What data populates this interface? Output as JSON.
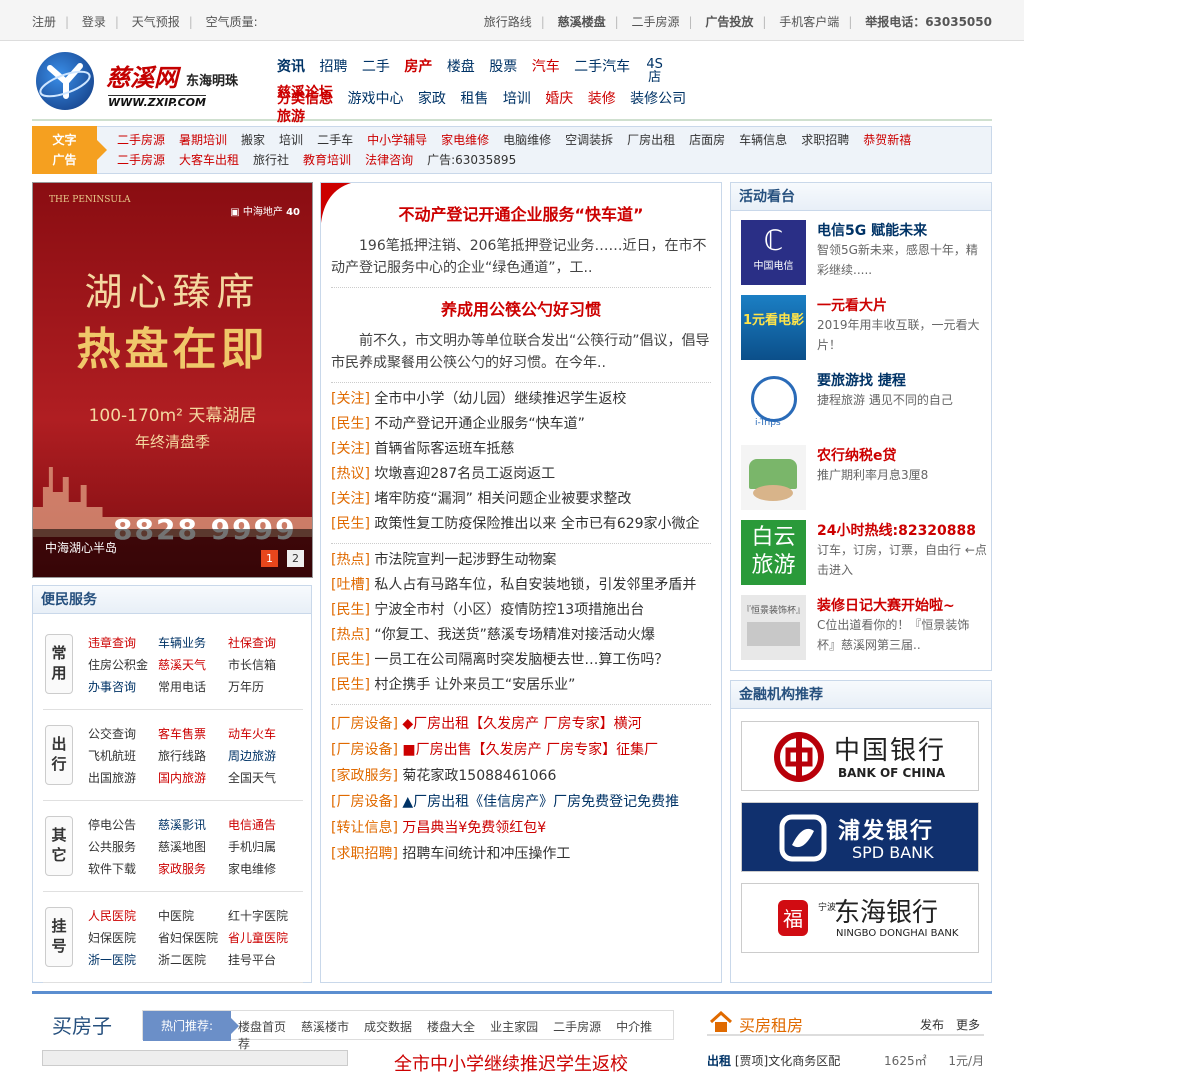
{
  "topbar": {
    "left": [
      "注册",
      "登录",
      "天气预报",
      "空气质量:"
    ],
    "right": [
      "旅行路线",
      "慈溪楼盘",
      "二手房源",
      "广告投放",
      "手机客户端"
    ],
    "hotline": "举报电话：63035050"
  },
  "logo": {
    "name": "慈溪网",
    "slogan": "东海明珠",
    "url": "WWW.ZXIP.COM"
  },
  "nav": {
    "row1": [
      "资讯",
      "招聘",
      "二手",
      "房产",
      "楼盘",
      "股票",
      "汽车",
      "二手汽车",
      "4S店",
      "慈溪论坛"
    ],
    "row2": [
      "分类信息",
      "游戏中心",
      "家政",
      "租售",
      "培训",
      "婚庆",
      "装修",
      "装修公司",
      "旅游"
    ]
  },
  "text_ad": {
    "label": [
      "文字",
      "广告"
    ],
    "items": [
      "二手房源",
      "暑期培训",
      "搬家",
      "培训",
      "二手车",
      "中小学辅导",
      "家电维修",
      "电脑维修",
      "空调装拆",
      "厂房出租",
      "店面房",
      "车辆信息",
      "求职招聘",
      "恭贺新禧",
      "二手房源",
      "大客车出租",
      "旅行社",
      "教育培训",
      "法律咨询",
      "广告:63035895"
    ]
  },
  "banner": {
    "peninsula": "THE PENINSULA",
    "brand": "40",
    "line1": "湖心臻席",
    "line2": "热盘在即",
    "line3": "100-170m² 天幕湖居",
    "line4": "年终清盘季",
    "phone": "8828 9999",
    "caption": "中海湖心半岛",
    "pages": [
      "1",
      "2"
    ]
  },
  "convenience": {
    "title": "便民服务",
    "groups": [
      {
        "tag": "常用",
        "links": [
          "违章查询",
          "车辆业务",
          "社保查询",
          "住房公积金",
          "慈溪天气",
          "市长信箱",
          "办事咨询",
          "常用电话",
          "万年历"
        ]
      },
      {
        "tag": "出行",
        "links": [
          "公交查询",
          "客车售票",
          "动车火车",
          "飞机航班",
          "旅行线路",
          "周边旅游",
          "出国旅游",
          "国内旅游",
          "全国天气"
        ]
      },
      {
        "tag": "其它",
        "links": [
          "停电公告",
          "慈溪影讯",
          "电信通告",
          "公共服务",
          "慈溪地图",
          "手机归属",
          "软件下载",
          "家政服务",
          "家电维修"
        ]
      },
      {
        "tag": "挂号",
        "links": [
          "人民医院",
          "中医院",
          "红十字医院",
          "妇保医院",
          "省妇保医院",
          "省儿童医院",
          "浙一医院",
          "浙二医院",
          "挂号平台"
        ]
      }
    ]
  },
  "news": {
    "headline1": "不动产登记开通企业服务“快车道”",
    "summary1": "196笔抵押注销、206笔抵押登记业务……近日，在市不动产登记服务中心的企业“绿色通道”，工..",
    "headline2": "养成用公筷公勺好习惯",
    "summary2": "前不久，市文明办等单位联合发出“公筷行动”倡议，倡导市民养成聚餐用公筷公勺的好习惯。在今年..",
    "list1": [
      {
        "cat": "[关注]",
        "text": "全市中小学（幼儿园）继续推迟学生返校"
      },
      {
        "cat": "[民生]",
        "text": "不动产登记开通企业服务“快车道”"
      },
      {
        "cat": "[关注]",
        "text": "首辆省际客运班车抵慈"
      },
      {
        "cat": "[热议]",
        "text": "坎墩喜迎287名员工返岗返工"
      },
      {
        "cat": "[关注]",
        "text": "堵牢防疫“漏洞” 相关问题企业被要求整改"
      },
      {
        "cat": "[民生]",
        "text": "政策性复工防疫保险推出以来 全市已有629家小微企"
      }
    ],
    "list2": [
      {
        "cat": "[热点]",
        "text": "市法院宣判一起涉野生动物案"
      },
      {
        "cat": "[吐槽]",
        "text": "私人占有马路车位，私自安装地锁，引发邻里矛盾并"
      },
      {
        "cat": "[民生]",
        "text": "宁波全市村（小区）疫情防控13项措施出台"
      },
      {
        "cat": "[热点]",
        "text": "“你复工、我送货”慈溪专场精准对接活动火爆"
      },
      {
        "cat": "[民生]",
        "text": "一员工在公司隔离时突发脑梗去世…算工伤吗？"
      },
      {
        "cat": "[民生]",
        "text": "村企携手 让外来员工“安居乐业”"
      }
    ],
    "list3": [
      {
        "cat": "[厂房设备]",
        "text": "◆厂房出租【久发房产 厂房专家】横河",
        "color": "r"
      },
      {
        "cat": "[厂房设备]",
        "text": "■厂房出售【久发房产 厂房专家】征集厂",
        "color": "r"
      },
      {
        "cat": "[家政服务]",
        "text": "菊花家政15088461066",
        "color": "d"
      },
      {
        "cat": "[厂房设备]",
        "text": "▲厂房出租《佳信房产》厂房免费登记免费推",
        "color": "b"
      },
      {
        "cat": "[转让信息]",
        "text": "万昌典当¥免费领红包¥",
        "color": "r"
      },
      {
        "cat": "[求职招聘]",
        "text": "招聘车间统计和冲压操作工",
        "color": "d"
      }
    ]
  },
  "activity": {
    "title": "活动看台",
    "items": [
      {
        "title": "电信5G 赋能未来",
        "desc": "智领5G新未来，感恩十年，精彩继续.....",
        "color": "#036"
      },
      {
        "title": "一元看大片",
        "desc": "2019年用丰收互联，一元看大片！",
        "color": "#c00"
      },
      {
        "title": "要旅游找 捷程",
        "desc": "捷程旅游 遇见不同的自己",
        "color": "#036"
      },
      {
        "title": "农行纳税e贷",
        "desc": "推广期利率月息3厘8",
        "color": "#c00"
      },
      {
        "title": "24小时热线:82320888",
        "desc": "订车，订房，订票，自由行 ←点击进入",
        "color": "#c00"
      },
      {
        "title": "装修日记大赛开始啦~",
        "desc": "C位出道看你的！『恒景装饰杯』慈溪网第三届..",
        "color": "#c00"
      }
    ],
    "pic_text": {
      "telecom": "中国电信",
      "movie": "1元看电影",
      "itrips": "i-Trips",
      "cloud": "白云旅游",
      "decor": "『恒景装饰杯』"
    }
  },
  "banks": {
    "title": "金融机构推荐",
    "boc": {
      "cn": "中国银行",
      "en": "BANK OF CHINA"
    },
    "spd": {
      "cn": "浦发银行",
      "en": "SPD BANK"
    },
    "dh": {
      "cn": "东海银行",
      "en": "NINGBO DONGHAI BANK",
      "small": "宁波"
    }
  },
  "bottom": {
    "title": "买房子",
    "hot_label": "热门推荐:",
    "hot_links": [
      "楼盘首页",
      "慈溪楼市",
      "成交数据",
      "楼盘大全",
      "业主家园",
      "二手房源",
      "中介推荐"
    ],
    "news_title": "全市中小学继续推迟学生返校",
    "rent_title": "买房租房",
    "rent_publish": "发布",
    "rent_more": "更多",
    "rent_row": {
      "cat": "出租",
      "text": "[贾项]文化商务区配",
      "area": "1625㎡",
      "price": "1元/月"
    }
  },
  "colors": {
    "accent_red": "#c00",
    "nav_blue": "#036",
    "ad_orange": "#f5a020",
    "box_border": "#c9d8ea"
  }
}
